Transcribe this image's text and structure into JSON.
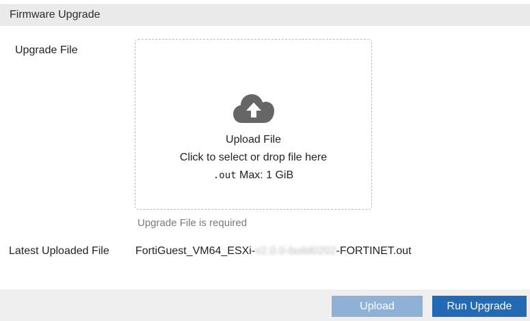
{
  "header": {
    "title": "Firmware Upgrade"
  },
  "form": {
    "upgrade_file_label": "Upgrade File",
    "dropzone": {
      "icon": "cloud-upload-icon",
      "title": "Upload File",
      "hint": "Click to select or drop file here",
      "extension": ".out",
      "max_size": "Max: 1 GiB"
    },
    "error_message": "Upgrade File is required",
    "latest_label": "Latest Uploaded File",
    "latest_file": {
      "prefix": "FortiGuest_VM64_ESXi-",
      "redacted": "v2.0.0-build0202",
      "suffix": "-FORTINET.out"
    }
  },
  "footer": {
    "upload_label": "Upload",
    "run_upgrade_label": "Run Upgrade"
  },
  "colors": {
    "header_bg": "#eaeaea",
    "upload_button_disabled": "#8fb1d6",
    "primary_button": "#2369b3",
    "icon_gray": "#666666"
  }
}
